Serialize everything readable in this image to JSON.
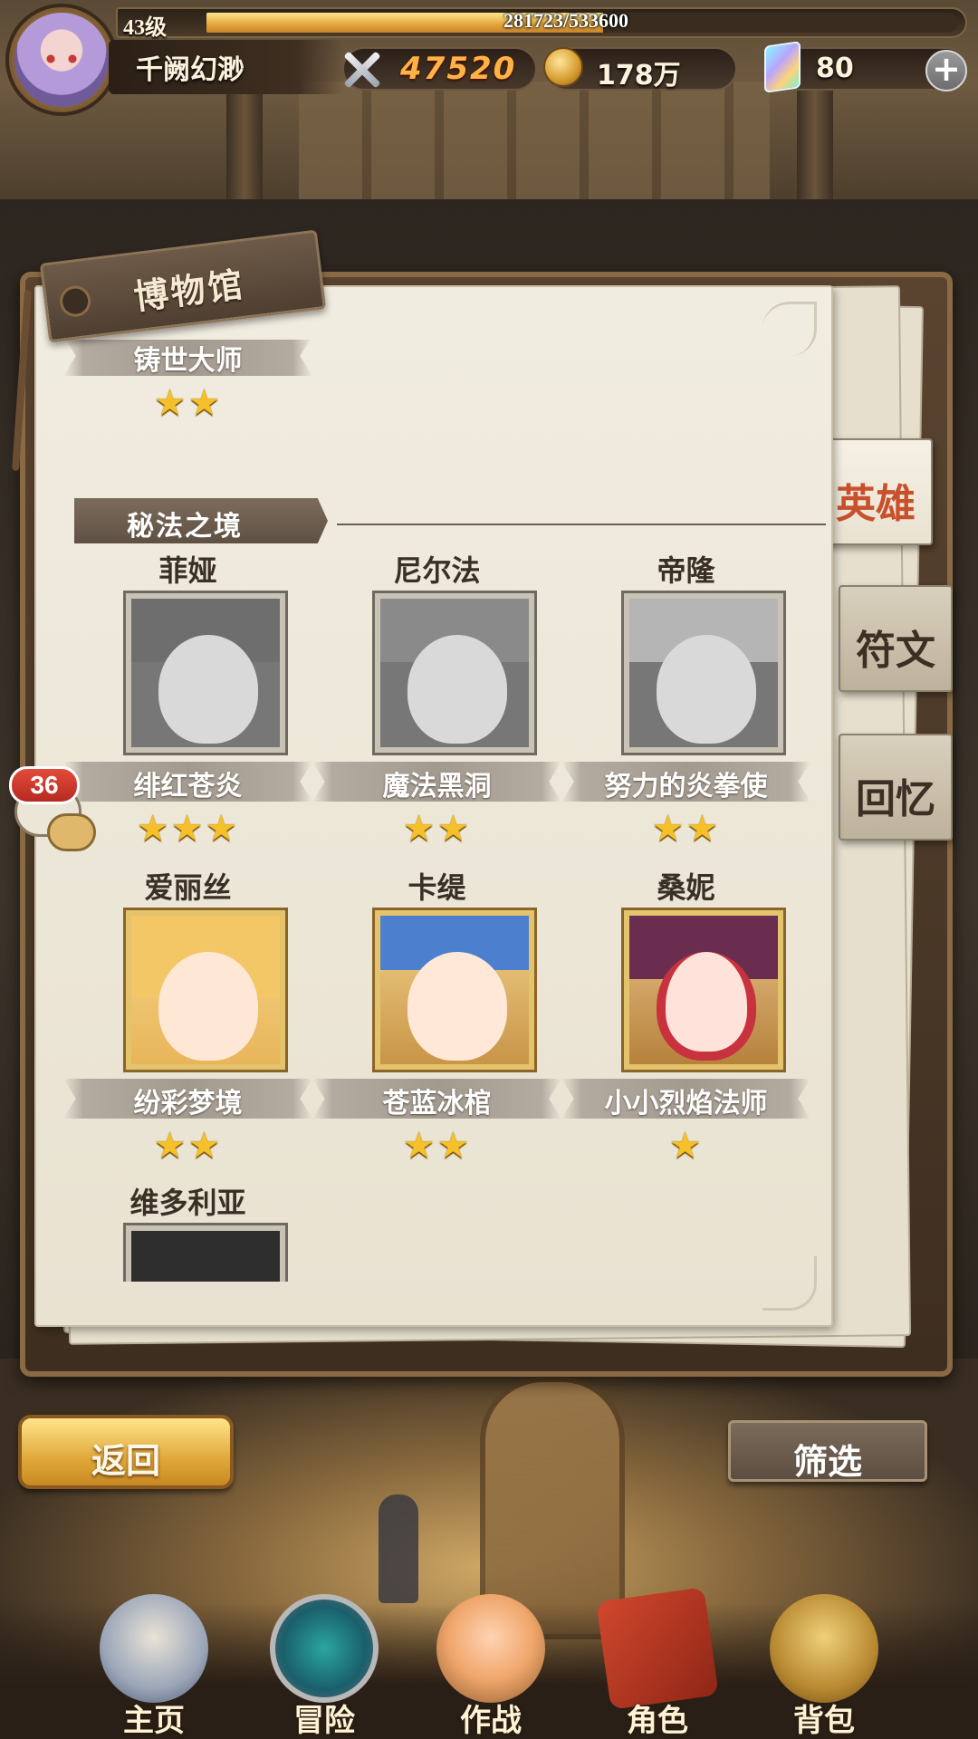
{
  "player": {
    "level": "43级",
    "exp_text": "281723/533600",
    "exp_progress": 0.528,
    "name": "千阙幻渺",
    "power": "47520",
    "gold": "178万",
    "gems": "80"
  },
  "museum": {
    "title": "博物馆",
    "partial_card": {
      "title": "铸世大师",
      "stars": "★★"
    },
    "section": "秘法之境",
    "heroes": [
      {
        "name": "菲娅",
        "title": "绯红苍炎",
        "stars": "★★★",
        "unlocked": false
      },
      {
        "name": "尼尔法",
        "title": "魔法黑洞",
        "stars": "★★",
        "unlocked": false
      },
      {
        "name": "帝隆",
        "title": "努力的炎拳使",
        "stars": "★★",
        "unlocked": false
      },
      {
        "name": "爱丽丝",
        "title": "纷彩梦境",
        "stars": "★★",
        "unlocked": true
      },
      {
        "name": "卡缇",
        "title": "苍蓝冰棺",
        "stars": "★★",
        "unlocked": true
      },
      {
        "name": "桑妮",
        "title": "小小烈焰法师",
        "stars": "★",
        "unlocked": true
      },
      {
        "name": "维多利亚",
        "title": "",
        "stars": "",
        "unlocked": false
      }
    ]
  },
  "tabs": {
    "heroes": "英雄",
    "runes": "符文",
    "memories": "回忆"
  },
  "chat": {
    "count": "36"
  },
  "buttons": {
    "back": "返回",
    "filter": "筛选"
  },
  "nav": {
    "home": "主页",
    "adventure": "冒险",
    "battle": "作战",
    "character": "角色",
    "bag": "背包"
  },
  "colors": {
    "accent_gold": "#e0a83a",
    "active_tab_text": "#c8502c",
    "page_paper": "#f1ece0",
    "badge_red": "#e34a3a"
  },
  "icons": {
    "power": "crossed-swords-icon",
    "gold": "gold-coin-icon",
    "gems": "rainbow-gem-icon",
    "plus": "plus-icon",
    "chat": "chat-bubble-icon"
  }
}
